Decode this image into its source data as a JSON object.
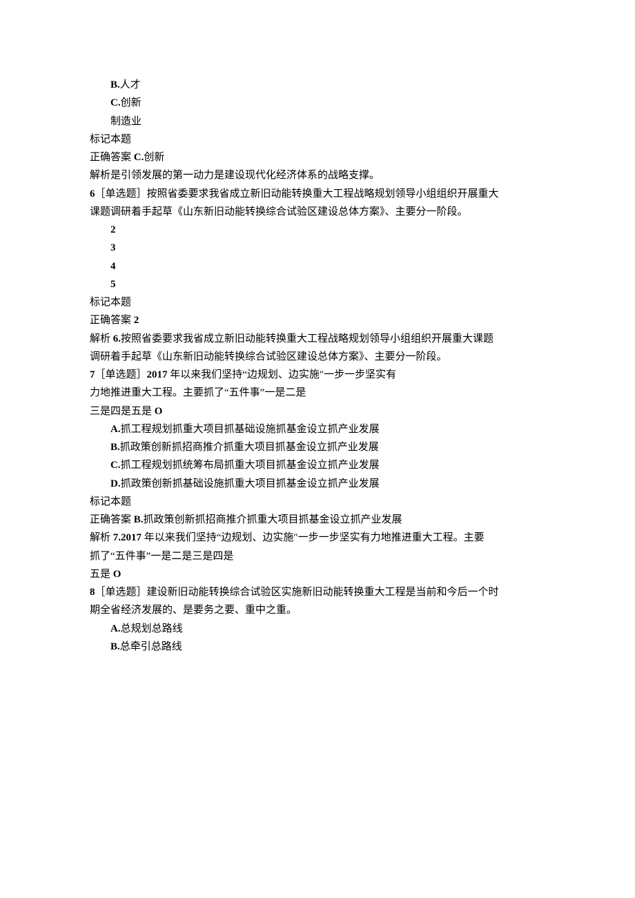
{
  "q5_partial": {
    "option_b_prefix": "B.",
    "option_b_text": "人才",
    "option_c_prefix": "C.",
    "option_c_text": "创新",
    "option_d_text": "制造业",
    "mark_label": "标记本题",
    "correct_prefix": "正确答案 ",
    "correct_option_prefix": "C.",
    "correct_option_text": "创新",
    "analysis": "解析是引领发展的第一动力是建设现代化经济体系的战略支撑。"
  },
  "q6": {
    "number": "6",
    "type_label": "［单选题］",
    "stem_line1": "按照省委要求我省成立新旧动能转换重大工程战略规划领导小组组织开展重大",
    "stem_line2": "课题调研着手起草《山东新旧动能转换综合试验区建设总体方案》、主要分一阶段。",
    "opt_a": "2",
    "opt_b": "3",
    "opt_c": "4",
    "opt_d": "5",
    "mark_label": "标记本题",
    "correct_prefix": "正确答案 ",
    "correct_value": "2",
    "analysis_line1_prefix": "解析 ",
    "analysis_line1_num": "6.",
    "analysis_line1_text": "按照省委要求我省成立新旧动能转换重大工程战略规划领导小组组织开展重大课题",
    "analysis_line2": "调研着手起草《山东新旧动能转换综合试验区建设总体方案》、主要分一阶段。"
  },
  "q7": {
    "number": "7",
    "type_label": "［单选题］",
    "year": "2017 ",
    "stem_line1": "年以来我们坚持“边规划、边实施″一步一步坚实有",
    "stem_line2": "力地推进重大工程。主要抓了“五件事”一是二是",
    "stem_line3a": "三是四是五是 ",
    "stem_line3b": "O",
    "option_a_prefix": "A.",
    "option_a_text": "抓工程规划抓重大项目抓基础设施抓基金设立抓产业发展",
    "option_b_prefix": "B.",
    "option_b_text": "抓政策创新抓招商推介抓重大项目抓基金设立抓产业发展",
    "option_c_prefix": "C.",
    "option_c_text": "抓工程规划抓统筹布局抓重大项目抓基金设立抓产业发展",
    "option_d_prefix": "D.",
    "option_d_text": "抓政策创新抓基础设施抓重大项目抓基金设立抓产业发展",
    "mark_label": "标记本题",
    "correct_prefix": "正确答案 ",
    "correct_option_prefix": "B.",
    "correct_option_text": "抓政策创新抓招商推介抓重大项目抓基金设立抓产业发展",
    "analysis_line1_prefix": "解析 ",
    "analysis_line1_num": "7.2017 ",
    "analysis_line1_text": "年以来我们坚持“边规划、边实施″一步一步坚实有力地推进重大工程。主要",
    "analysis_line2": "抓了“五件事”一是二是三是四是",
    "analysis_line3a": "五是 ",
    "analysis_line3b": "O"
  },
  "q8": {
    "number": "8",
    "type_label": "［单选题］",
    "stem_line1": "建设新旧动能转换综合试验区实施新旧动能转换重大工程是当前和今后一个时",
    "stem_line2": "期全省经济发展的、是要务之要、重中之重。",
    "option_a_prefix": "A.",
    "option_a_text": "总规划总路线",
    "option_b_prefix": "B.",
    "option_b_text": "总牵引总路线"
  }
}
